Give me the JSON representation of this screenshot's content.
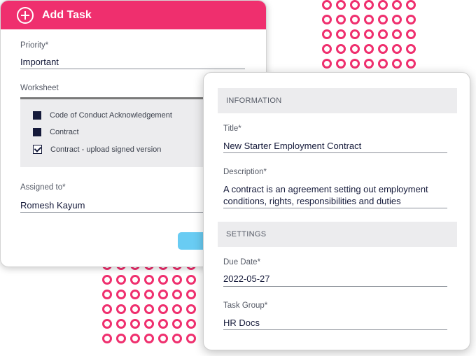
{
  "add_task": {
    "title": "Add Task",
    "priority_label": "Priority*",
    "priority_value": "Important",
    "worksheet_label": "Worksheet",
    "worksheet_items": [
      {
        "label": "Code of Conduct Acknowledgement",
        "checked": false
      },
      {
        "label": "Contract",
        "checked": false
      },
      {
        "label": "Contract - upload signed version",
        "checked": true
      }
    ],
    "assigned_label": "Assigned to*",
    "assigned_value": "Romesh Kayum"
  },
  "detail": {
    "information_header": "INFORMATION",
    "title_label": "Title*",
    "title_value": "New Starter Employment Contract",
    "description_label": "Description*",
    "description_line1": "A contract is an agreement setting out employment",
    "description_line2": "conditions, rights, responsibilities and duties",
    "settings_header": "SETTINGS",
    "due_date_label": "Due Date*",
    "due_date_value": "2022-05-27",
    "task_group_label": "Task Group*",
    "task_group_value": "HR Docs"
  },
  "colors": {
    "accent": "#ef2f6e",
    "button": "#69ccf3",
    "text_dark": "#151a3a"
  },
  "icons": {
    "add": "plus-circle-icon"
  }
}
